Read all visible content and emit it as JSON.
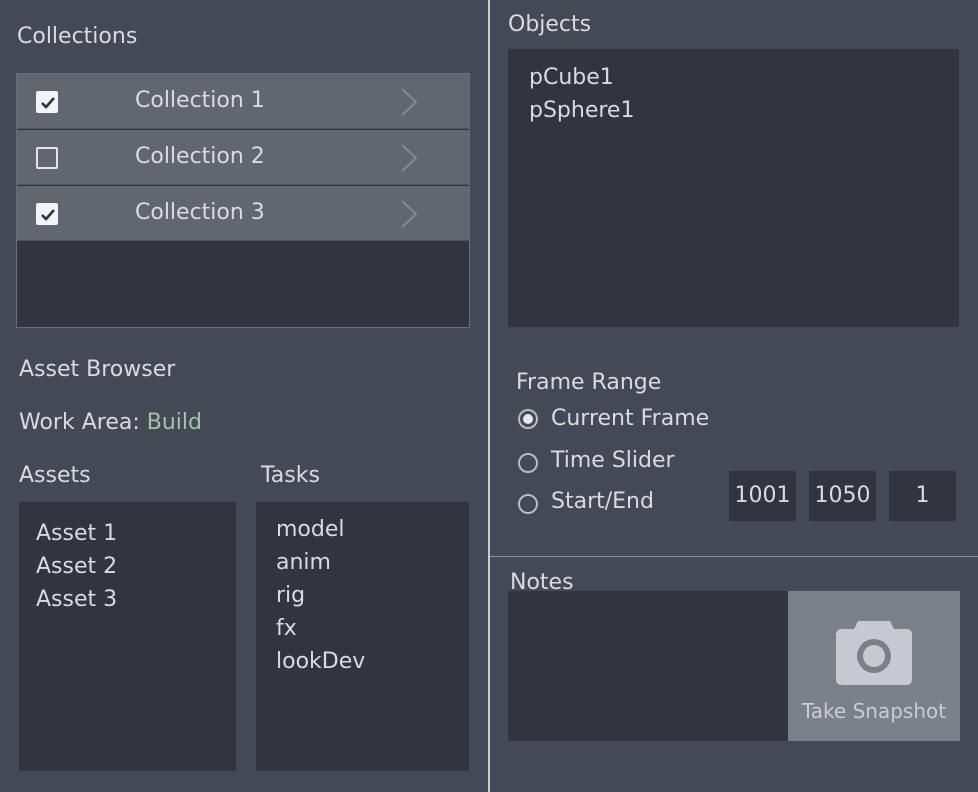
{
  "collections": {
    "title": "Collections",
    "items": [
      {
        "label": "Collection 1",
        "checked": true
      },
      {
        "label": "Collection 2",
        "checked": false
      },
      {
        "label": "Collection 3",
        "checked": true
      }
    ]
  },
  "asset_browser": {
    "title": "Asset Browser",
    "work_area_label": "Work Area:",
    "work_area_value": "Build",
    "work_area_color": "#9fc4a6",
    "assets_title": "Assets",
    "assets": [
      "Asset 1",
      "Asset 2",
      "Asset 3"
    ],
    "tasks_title": "Tasks",
    "tasks": [
      "model",
      "anim",
      "rig",
      "fx",
      "lookDev"
    ]
  },
  "objects": {
    "title": "Objects",
    "items": [
      "pCube1",
      "pSphere1"
    ]
  },
  "frame_range": {
    "title": "Frame Range",
    "options": [
      {
        "label": "Current Frame",
        "selected": true
      },
      {
        "label": "Time Slider",
        "selected": false
      },
      {
        "label": "Start/End",
        "selected": false
      }
    ],
    "start": "1001",
    "end": "1050",
    "step": "1"
  },
  "notes": {
    "title": "Notes",
    "snapshot_label": "Take Snapshot",
    "snapshot_icon": "camera-icon"
  }
}
